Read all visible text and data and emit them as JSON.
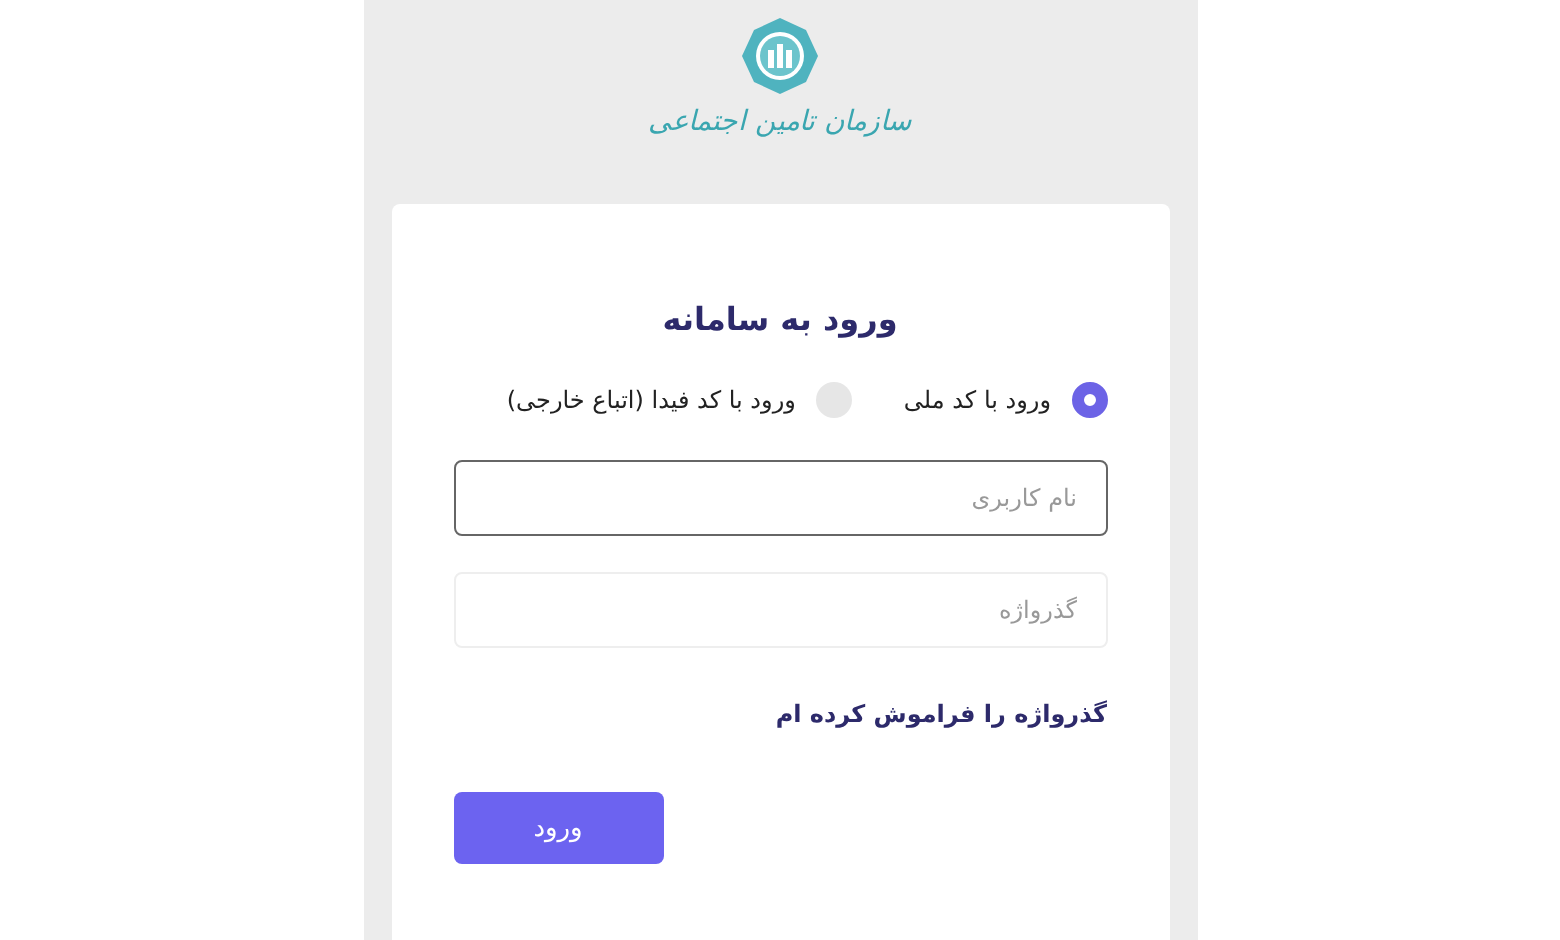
{
  "logo": {
    "caption": "سازمان تامین اجتماعی"
  },
  "login": {
    "title": "ورود به سامانه",
    "login_methods": [
      {
        "label": "ورود با کد ملی",
        "selected": true
      },
      {
        "label": "ورود با کد فیدا (اتباع خارجی)",
        "selected": false
      }
    ],
    "fields": [
      {
        "placeholder": "نام کاربری",
        "focused": true
      },
      {
        "placeholder": "گذرواژه",
        "focused": false
      }
    ],
    "forgot_link": "گذرواژه را فراموش کرده ام",
    "submit": "ورود"
  }
}
